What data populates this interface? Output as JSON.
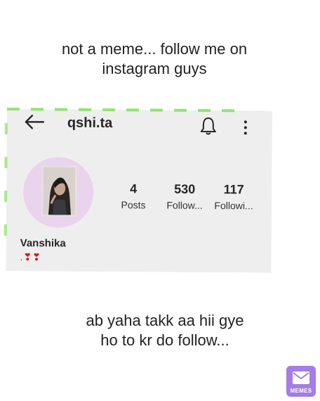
{
  "captions": {
    "top": "not a meme... follow me on instagram guys",
    "bottom": "ab yaha takk aa hii gye ho to kr do follow..."
  },
  "profile": {
    "username": "qshi.ta",
    "display_name": "Vanshika",
    "bio": ".❣❣",
    "stats": [
      {
        "value": "4",
        "label": "Posts"
      },
      {
        "value": "530",
        "label": "Follow..."
      },
      {
        "value": "117",
        "label": "Followi..."
      }
    ]
  },
  "icons": {
    "back": "arrow-left",
    "notifications": "bell",
    "more": "vertical-ellipsis"
  },
  "watermark": {
    "label": "MEMES"
  },
  "colors": {
    "avatar_ring": "#ead3ec",
    "bio_hearts": "#c81e2a",
    "watermark_bg": "#a67ce6"
  }
}
